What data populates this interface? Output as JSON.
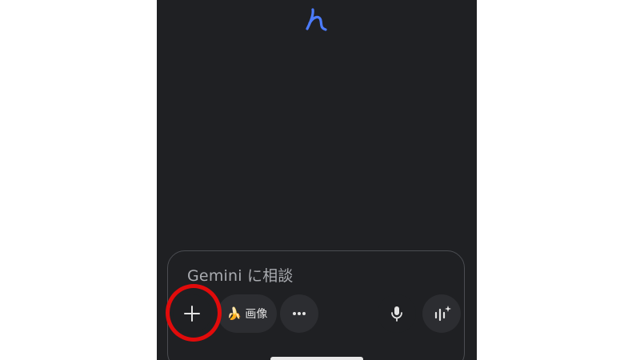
{
  "screen": {
    "background": "#1f2023",
    "accent": "#4c7cff"
  },
  "composer": {
    "placeholder": "Gemini に相談",
    "image_chip": {
      "emoji": "🍌",
      "label": "画像"
    }
  },
  "icons": {
    "top_glyph": "gemini-glyph-icon",
    "add": "plus-icon",
    "more": "more-horizontal-icon",
    "mic": "microphone-icon",
    "live": "live-audio-icon"
  },
  "annotation": {
    "ring_color": "#e10b0b"
  }
}
